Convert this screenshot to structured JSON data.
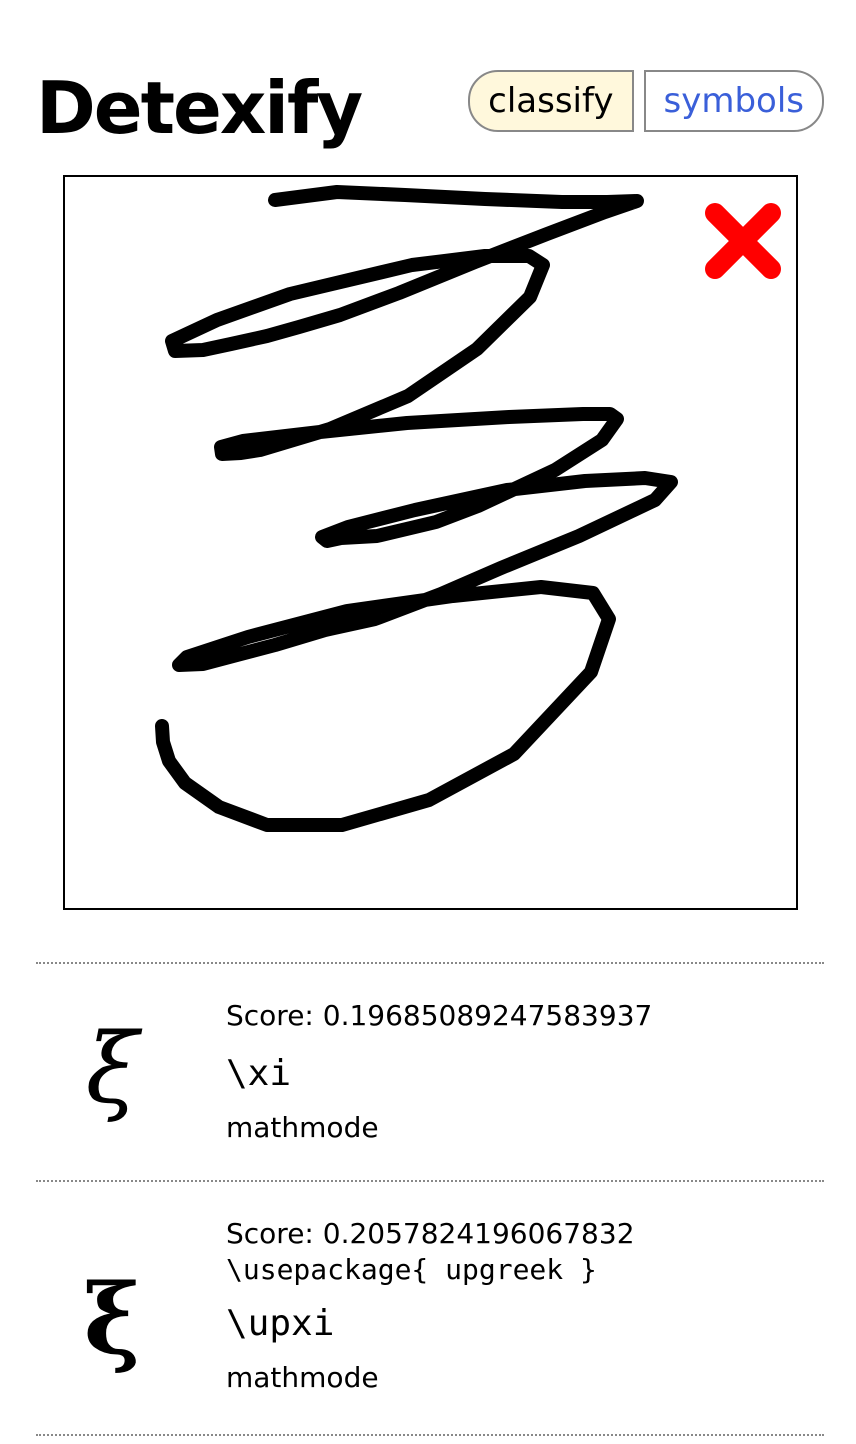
{
  "header": {
    "title": "Detexify",
    "nav": {
      "classify_label": "classify",
      "symbols_label": "symbols"
    }
  },
  "canvas": {
    "clear_icon": "close-x-icon",
    "clear_color": "#ff0000",
    "stroke_color": "#000000"
  },
  "results": [
    {
      "glyph": "ξ",
      "score_label": "Score: 0.19685089247583937",
      "package": "",
      "command": "\\xi",
      "mode": "mathmode"
    },
    {
      "glyph": "ξ",
      "score_label": "Score: 0.2057824196067832",
      "package": "\\usepackage{ upgreek }",
      "command": "\\upxi",
      "mode": "mathmode"
    }
  ],
  "colors": {
    "classify_bg": "#fff8dc",
    "symbols_link": "#3a5fd9",
    "divider": "#888888"
  }
}
